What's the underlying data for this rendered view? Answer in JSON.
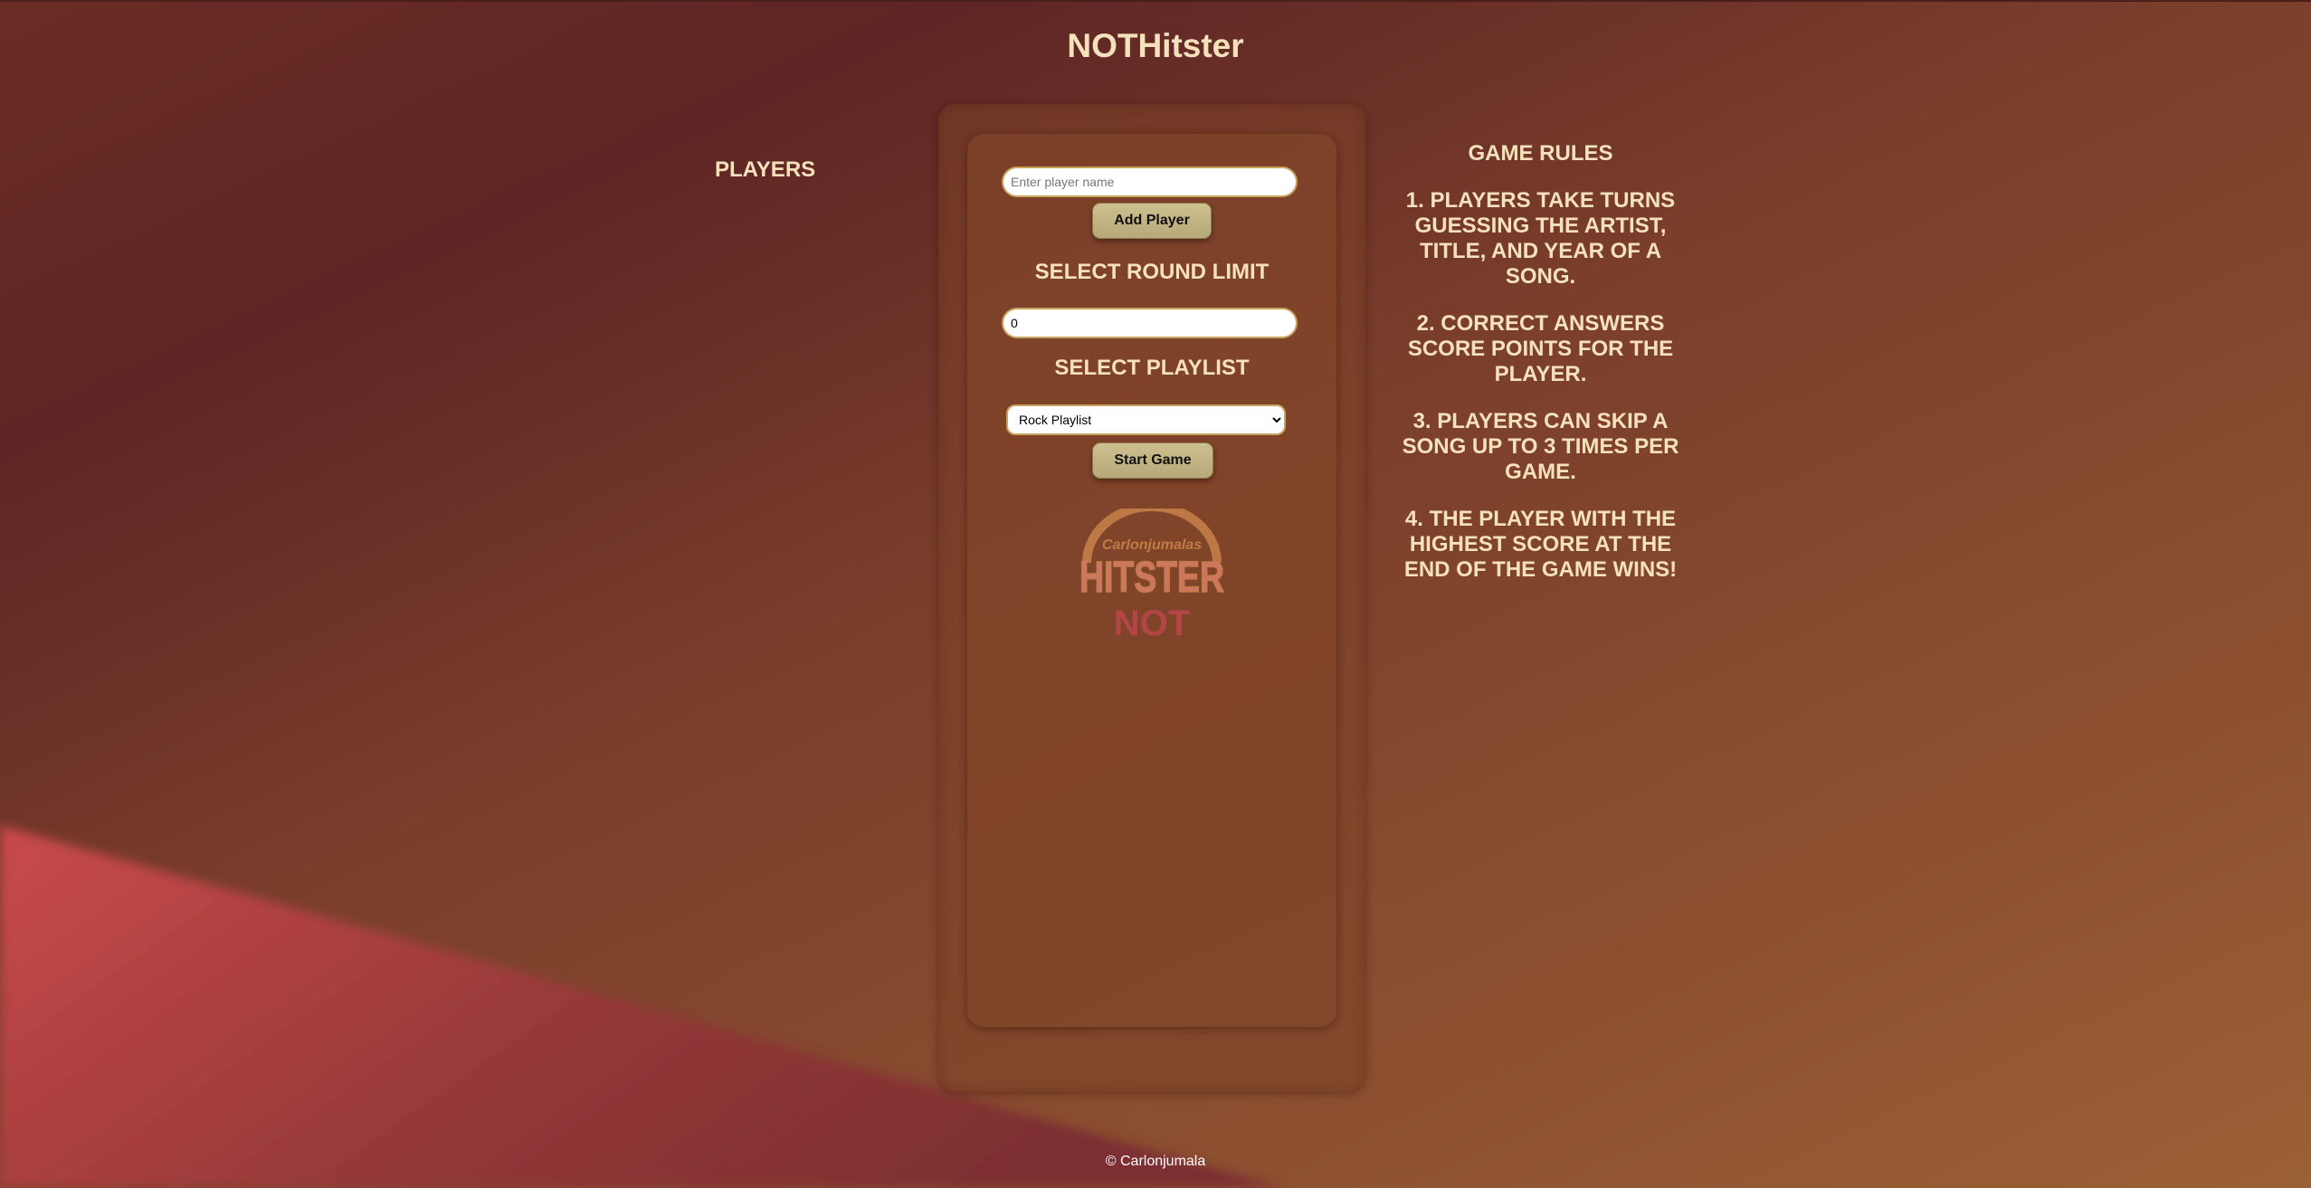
{
  "app": {
    "title": "NOTHitster"
  },
  "players": {
    "heading": "PLAYERS"
  },
  "setup": {
    "player_name_placeholder": "Enter player name",
    "add_player_label": "Add Player",
    "round_limit_heading": "SELECT ROUND LIMIT",
    "round_limit_value": "0",
    "playlist_heading": "SELECT PLAYLIST",
    "playlist_selected": "Rock Playlist",
    "start_game_label": "Start Game"
  },
  "logo": {
    "line1": "Carlonjumalas",
    "line2": "HITSTER",
    "line3": "NOT"
  },
  "rules": {
    "heading": "GAME RULES",
    "items": [
      "1. PLAYERS TAKE TURNS GUESSING THE ARTIST, TITLE, AND YEAR OF A SONG.",
      "2. CORRECT ANSWERS SCORE POINTS FOR THE PLAYER.",
      "3. PLAYERS CAN SKIP A SONG UP TO 3 TIMES PER GAME.",
      "4. THE PLAYER WITH THE HIGHEST SCORE AT THE END OF THE GAME WINS!"
    ]
  },
  "footer": {
    "copyright": "© Carlonjumala"
  },
  "colors": {
    "text": "#f6e1bd",
    "button": "#c4b685",
    "field_border": "#c9a45c",
    "logo_orange": "#c9814a",
    "logo_red": "#c4545a"
  }
}
